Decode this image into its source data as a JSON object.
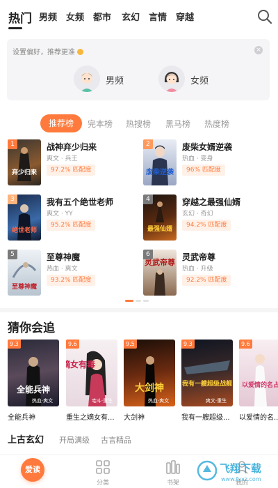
{
  "nav": {
    "tabs": [
      {
        "label": "热门",
        "active": true
      },
      {
        "label": "男频"
      },
      {
        "label": "女频"
      },
      {
        "label": "都市"
      },
      {
        "label": "玄幻"
      },
      {
        "label": "言情"
      },
      {
        "label": "穿越"
      }
    ],
    "search_icon": "search-icon"
  },
  "pref": {
    "tip": "设置偏好，推荐更准",
    "male_label": "男频",
    "female_label": "女频",
    "close_icon": "close-icon"
  },
  "rank_tabs": [
    "推荐榜",
    "完本榜",
    "热搜榜",
    "黑马榜",
    "热度榜"
  ],
  "rank_items": [
    {
      "rank": "1",
      "title": "战神弃少归来",
      "meta": "爽文 · 兵王",
      "match": "97.2% 匹配度",
      "badge_color": "#ff7a3c"
    },
    {
      "rank": "2",
      "title": "废柴女婿逆袭",
      "meta": "热血 · 变身",
      "match": "96% 匹配度",
      "badge_color": "#ff9a5c"
    },
    {
      "rank": "3",
      "title": "我有五个绝世老师",
      "meta": "爽文 · YY",
      "match": "95.2% 匹配度",
      "badge_color": "#ffb37c"
    },
    {
      "rank": "4",
      "title": "穿越之最强仙婿",
      "meta": "玄幻 · 奇幻",
      "match": "94.2% 匹配度",
      "badge_color": "#7a7a7a"
    },
    {
      "rank": "5",
      "title": "至尊神魔",
      "meta": "热血 · 爽文",
      "match": "93.2% 匹配度",
      "badge_color": "#7a7a7a"
    },
    {
      "rank": "6",
      "title": "灵武帝尊",
      "meta": "热血 · 升级",
      "match": "92.2% 匹配度",
      "badge_color": "#7a7a7a"
    }
  ],
  "guess": {
    "title": "猜你会追",
    "books": [
      {
        "score": "9.3",
        "name": "全能兵神",
        "cover_text": "全能兵神",
        "cover_tag": "热血·爽文"
      },
      {
        "score": "9.6",
        "name": "重生之嫡女有...",
        "cover_text": "嫡女有毒",
        "cover_tag": "宅斗·重生"
      },
      {
        "score": "9.5",
        "name": "大剑神",
        "cover_text": "大剑神",
        "cover_tag": "热血·爽文"
      },
      {
        "score": "9.3",
        "name": "我有一艘超级...",
        "cover_text": "我有一艘超级战舰",
        "cover_tag": "爽文·重生"
      },
      {
        "score": "9.6",
        "name": "以爱情的名...",
        "cover_text": "以爱情的名占有你",
        "cover_tag": ""
      }
    ]
  },
  "subsection": {
    "main": "上古玄幻",
    "tags": [
      "开局满级",
      "古言精品"
    ]
  },
  "bottom": {
    "items": [
      {
        "label": "爱读",
        "active": true
      },
      {
        "label": "分类"
      },
      {
        "label": "书架"
      },
      {
        "label": "我的"
      }
    ]
  },
  "watermark": {
    "text": "飞翔下载",
    "sub": "www.fxxz.com"
  },
  "colors": {
    "accent": "#ff7a3c",
    "soft_accent": "#fff1e8"
  }
}
